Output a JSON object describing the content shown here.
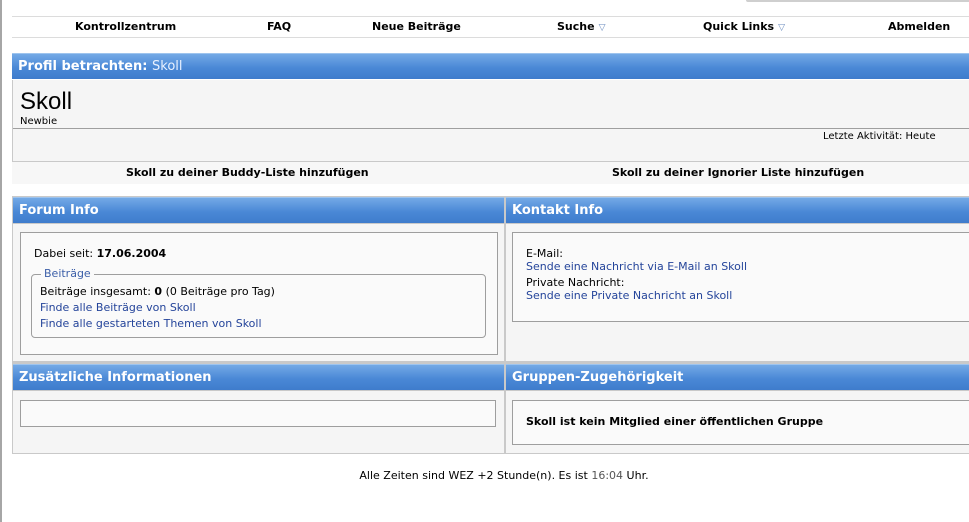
{
  "navbar": {
    "items": [
      {
        "label": "Kontrollzentrum"
      },
      {
        "label": "FAQ"
      },
      {
        "label": "Neue Beiträge"
      },
      {
        "label": "Suche"
      },
      {
        "label": "Quick Links"
      },
      {
        "label": "Abmelden"
      }
    ]
  },
  "profile": {
    "header_label": "Profil betrachten:",
    "header_user": "Skoll",
    "username": "Skoll",
    "rank": "Newbie",
    "last_activity": "Letzte Aktivität: Heute"
  },
  "actions": {
    "add_buddy": "Skoll zu deiner Buddy-Liste hinzufügen",
    "add_ignore": "Skoll zu deiner Ignorier Liste hinzufügen"
  },
  "forum_info": {
    "title": "Forum Info",
    "member_since_label": "Dabei seit:",
    "member_since_value": "17.06.2004",
    "posts_legend": "Beiträge",
    "posts_total_label": "Beiträge insgesamt:",
    "posts_total_value": "0",
    "posts_per_day": "(0 Beiträge pro Tag)",
    "find_posts": "Finde alle Beiträge von Skoll",
    "find_threads": "Finde alle gestarteten Themen von Skoll"
  },
  "contact_info": {
    "title": "Kontakt Info",
    "email_label": "E-Mail:",
    "email_link": "Sende eine Nachricht via E-Mail an Skoll",
    "pm_label": "Private Nachricht:",
    "pm_link": "Sende eine Private Nachricht an Skoll"
  },
  "additional_info": {
    "title": "Zusätzliche Informationen"
  },
  "groups": {
    "title": "Gruppen-Zugehörigkeit",
    "text": "Skoll ist kein Mitglied einer öffentlichen Gruppe"
  },
  "footer": {
    "prefix": "Alle Zeiten sind WEZ +2 Stunde(n). Es ist",
    "time": "16:04",
    "suffix": "Uhr."
  },
  "colors": {
    "header_blue": "#4a88d6",
    "link_blue": "#24449a"
  }
}
